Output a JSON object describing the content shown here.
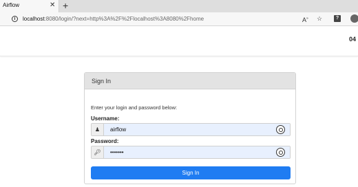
{
  "browser": {
    "tab_title": "Airflow",
    "tab_close": "✕",
    "new_tab": "+",
    "url_host": "localhost",
    "url_rest": ":8080/login/?next=http%3A%2F%2Flocalhost%3A8080%2Fhome",
    "icons": [
      "info-icon",
      "read-aloud-icon",
      "favorites-add-icon",
      "help-icon",
      "profile-icon"
    ]
  },
  "navbar": {
    "time_partial": "04"
  },
  "signin": {
    "title": "Sign In",
    "instructions": "Enter your login and password below:",
    "username_label": "Username:",
    "username_value": "airflow",
    "password_label": "Password:",
    "password_value": "•••••••",
    "submit_label": "Sign In"
  },
  "colors": {
    "primary_button": "#1f7cf2",
    "autofill_bg": "#e8f0fe",
    "panel_header": "#e3e3e3"
  }
}
